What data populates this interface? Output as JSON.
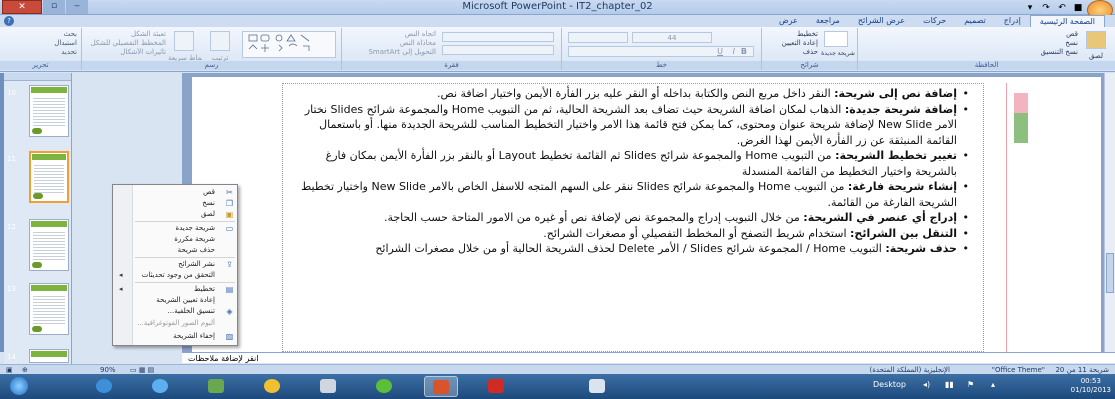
{
  "window": {
    "title": "Microsoft PowerPoint - IT2_chapter_02",
    "close_label": "✕",
    "restore_label": "▫",
    "minimize_label": "‒"
  },
  "ribbon": {
    "tabs": [
      {
        "label": "الصفحة الرئيسية",
        "active": true
      },
      {
        "label": "إدراج"
      },
      {
        "label": "تصميم"
      },
      {
        "label": "حركات"
      },
      {
        "label": "عرض الشرائح"
      },
      {
        "label": "مراجعة"
      },
      {
        "label": "عرض"
      }
    ],
    "groups": {
      "clipboard": {
        "label": "الحافظة",
        "items": [
          "قص",
          "نسخ",
          "نسخ التنسيق"
        ],
        "paste": "لصق"
      },
      "slides": {
        "label": "شرائح",
        "items": [
          "تخطيط",
          "إعادة التعيين",
          "حذف"
        ],
        "new_slide": "شريحة جديدة"
      },
      "font": {
        "label": "خط",
        "size": "44"
      },
      "paragraph": {
        "label": "فقرة",
        "items": [
          "اتجاه النص",
          "محاذاة النص",
          "التحويل إلى SmartArt"
        ]
      },
      "drawing": {
        "label": "رسم",
        "items": [
          "تعبئة الشكل",
          "المخطط التفصيلي للشكل",
          "تأثيرات الأشكال"
        ],
        "arrange": "ترتيب",
        "quick_styles": "أنماط سريعة"
      },
      "editing": {
        "label": "تحرير",
        "items": [
          "بحث",
          "استبدال",
          "تحديد"
        ]
      }
    }
  },
  "slides_pane": {
    "slide_numbers": [
      "10",
      "11",
      "12",
      "13",
      "14"
    ]
  },
  "context_menu": {
    "items": [
      {
        "label": "قص",
        "icon": "scissors-icon"
      },
      {
        "label": "نسخ",
        "icon": "copy-icon"
      },
      {
        "label": "لصق",
        "icon": "paste-icon"
      },
      {
        "label": "شريحة جديدة",
        "icon": "new-slide-icon"
      },
      {
        "label": "شريحة مكررة",
        "icon": ""
      },
      {
        "label": "حذف شريحة",
        "icon": ""
      },
      {
        "label": "نشر الشرائح",
        "icon": "publish-icon"
      },
      {
        "label": "التحقق من وجود تحديثات",
        "icon": "",
        "submenu": true
      },
      {
        "label": "تخطيط",
        "icon": "layout-icon",
        "submenu": true
      },
      {
        "label": "إعادة تعيين الشريحة",
        "icon": "reset-icon"
      },
      {
        "label": "تنسيق الخلفية...",
        "icon": "background-icon"
      },
      {
        "label": "ألبوم الصور الفوتوغرافية...",
        "icon": "",
        "disabled": true
      },
      {
        "label": "إخفاء الشريحة",
        "icon": "hide-slide-icon"
      }
    ]
  },
  "slide": {
    "bullets": [
      {
        "bold": "إضافة نص إلى شريحة:",
        "text": " النقر داخل مربع النص والكتابة بداخله أو النقر عليه بزر الفأرة الأيمن واختيار اضافة نص."
      },
      {
        "bold": "إضافة شريحة جديدة:",
        "text": " الذهاب لمكان اضافة الشريحة حيث تضاف بعد الشريحة الحالية، ثم من التبويب Home والمجموعة شرائح Slides نختار الامر New Slide لإضافة شريحة عنوان ومحتوى، كما يمكن فتح قائمة هذا الامر واختيار التخطيط المناسب للشريحة الجديدة منها. أو باستعمال القائمة المنبثقة عن زر الفأرة الأيمن لهذا الغرض."
      },
      {
        "bold": "تغيير تخطيط الشريحة:",
        "text": " من التبويب Home والمجموعة شرائح Slides ثم القائمة تخطيط Layout أو بالنقر بزر الفأرة الأيمن بمكان فارغ بالشريحة واختيار التخطيط من القائمة المنسدلة"
      },
      {
        "bold": "إنشاء شريحة فارغة:",
        "text": " من التبويب Home والمجموعة شرائح Slides ننقر على السهم المتجه للاسفل الخاص بالامر New Slide واختيار تخطيط الشريحة الفارغة من القائمة."
      },
      {
        "bold": "إدراج أي عنصر في الشريحة:",
        "text": " من خلال التبويب إدراج والمجموعة نص لإضافة نص أو غيره من الامور المتاحة حسب الحاجة."
      },
      {
        "bold": "التنقل بين الشرائح:",
        "text": " استخدام شريط التصفح أو المخطط التفصيلي أو مصغرات الشرائح."
      },
      {
        "bold": "حذف شريحة:",
        "text": " التبويب Home / المجموعة شرائح Slides / الأمر Delete لحذف الشريحة الحالية أو من خلال مصغرات الشرائح"
      }
    ]
  },
  "notes": {
    "placeholder": "انقر لإضافة ملاحظات"
  },
  "status_bar": {
    "slide_info": "شريحة 11 من 20",
    "theme": "\"Office Theme\"",
    "language": "الإنجليزية (المملكة المتحدة)",
    "zoom": "90%"
  },
  "taskbar": {
    "desktop_label": "Desktop",
    "time": "00:53",
    "date": "01/10/2013"
  },
  "colors": {
    "accent": "#7db33f",
    "selection": "#f0a030",
    "taskbar": "#1d4a7d"
  }
}
